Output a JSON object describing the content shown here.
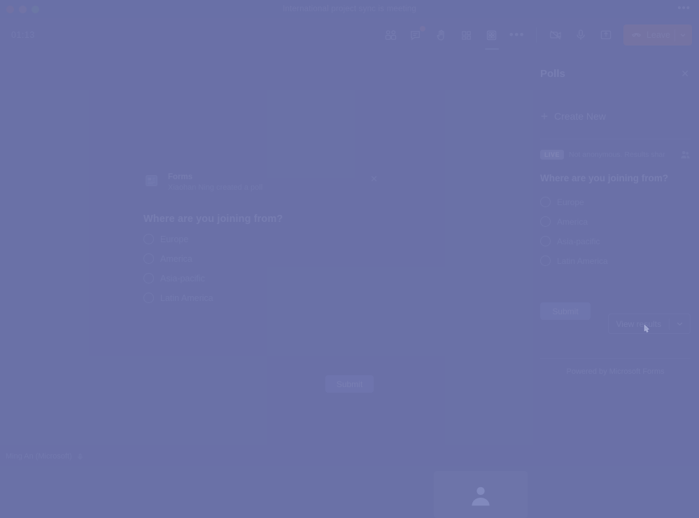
{
  "window": {
    "title": "International project sync is meeting",
    "menu_icon": "ellipsis-icon",
    "traffic_lights": [
      "close",
      "minimize",
      "maximize"
    ]
  },
  "toolbar": {
    "timer": "01:13",
    "items": [
      {
        "name": "people-icon",
        "label": "People"
      },
      {
        "name": "chat-icon",
        "label": "Chat",
        "badge": true
      },
      {
        "name": "raise-hand-icon",
        "label": "Raise hand"
      },
      {
        "name": "breakout-rooms-icon",
        "label": "Breakout rooms"
      },
      {
        "name": "apps-icon",
        "label": "Apps",
        "active": true
      },
      {
        "name": "more-options-icon",
        "label": "More"
      }
    ],
    "right_items": [
      {
        "name": "camera-off-icon",
        "label": "Camera off"
      },
      {
        "name": "microphone-icon",
        "label": "Microphone"
      },
      {
        "name": "share-screen-icon",
        "label": "Share screen"
      }
    ],
    "leave_label": "Leave",
    "leave_chevron": "chevron-down-icon",
    "leave_color": "#9a7c92"
  },
  "stage": {
    "poll_card": {
      "app_name": "Forms",
      "subtitle": "Xiaohan Ning created a poll",
      "close_icon": "close-icon",
      "question": "Where are you joining from?",
      "options": [
        "Europe",
        "America",
        "Asia-pacific",
        "Latin America"
      ],
      "submit_label": "Submit"
    },
    "self_name": "Ming An (Microsoft)",
    "self_mic_icon": "microphone-icon"
  },
  "panel": {
    "title": "Polls",
    "close_icon": "close-icon",
    "create_label": "Create New",
    "create_icon": "plus-icon",
    "live_badge": "LIVE",
    "live_text": "Not anonymous. Results shar",
    "live_people_icon": "people-icon",
    "question": "Where are you joining from?",
    "options": [
      "Europe",
      "America",
      "Asia-pacific",
      "Latin America"
    ],
    "submit_label": "Submit",
    "view_results_label": "View results",
    "view_results_chevron": "chevron-down-icon",
    "footer": "Powered by Microsoft Forms"
  },
  "colors": {
    "veil": "#6a71a7",
    "accent": "#7f85c3",
    "leave": "#9a7c92",
    "text": "#a6acd3"
  }
}
